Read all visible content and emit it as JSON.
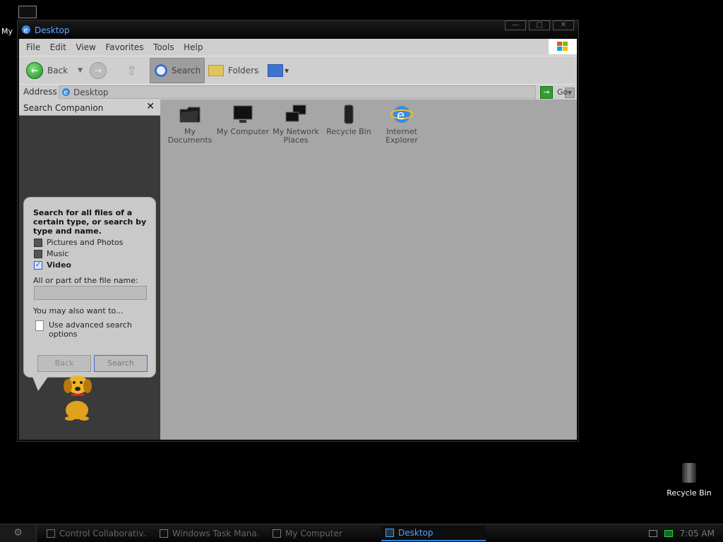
{
  "desktop": {
    "my_computer_label": "My",
    "recycle_bin_label": "Recycle Bin"
  },
  "window": {
    "title": "Desktop",
    "controls": [
      "—",
      "□",
      "✕"
    ]
  },
  "menu": [
    "File",
    "Edit",
    "View",
    "Favorites",
    "Tools",
    "Help"
  ],
  "toolbar": {
    "back_label": "Back",
    "search_label": "Search",
    "folders_label": "Folders"
  },
  "address": {
    "label": "Address",
    "value": "Desktop",
    "go_label": "Go"
  },
  "search_companion": {
    "title": "Search Companion",
    "intro": "Search for all files of a certain type, or search by type and name.",
    "options": [
      {
        "label": "Pictures and Photos",
        "checked": false
      },
      {
        "label": "Music",
        "checked": false
      },
      {
        "label": "Video",
        "checked": true
      }
    ],
    "filename_label": "All or part of the file name:",
    "filename_value": "",
    "also_label": "You may also want to...",
    "advanced_label": "Use advanced search options",
    "back_button": "Back",
    "search_button": "Search"
  },
  "items": [
    {
      "label": "My Documents",
      "icon": "folder-icon"
    },
    {
      "label": "My Computer",
      "icon": "computer-icon"
    },
    {
      "label": "My Network Places",
      "icon": "network-icon"
    },
    {
      "label": "Recycle Bin",
      "icon": "recycle-bin-icon"
    },
    {
      "label": "Internet Explorer",
      "icon": "internet-explorer-icon"
    }
  ],
  "taskbar": {
    "tasks": [
      {
        "label": "Control Collaborativ...",
        "active": false
      },
      {
        "label": "Windows Task Mana...",
        "active": false
      },
      {
        "label": "My Computer",
        "active": false
      },
      {
        "label": "Desktop",
        "active": true
      }
    ],
    "clock": "7:05 AM"
  },
  "colors": {
    "accent": "#4da3ff",
    "content_bg": "#a6a6a6",
    "pane_bg": "#3a3a3a"
  }
}
